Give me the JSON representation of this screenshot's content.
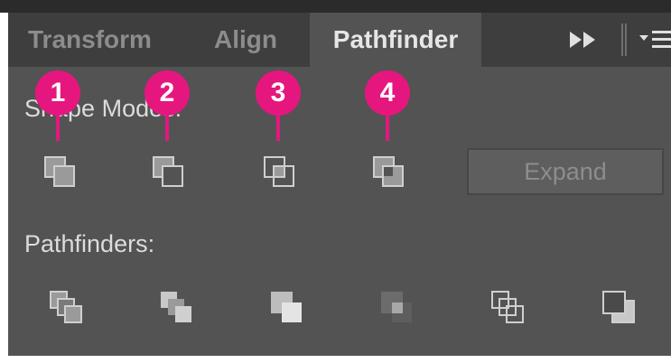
{
  "tabs": [
    {
      "label": "Transform",
      "active": false
    },
    {
      "label": "Align",
      "active": false
    },
    {
      "label": "Pathfinder",
      "active": true
    }
  ],
  "shape_modes": {
    "label": "Shape Modes:",
    "buttons": [
      "unite-icon",
      "minus-front-icon",
      "intersect-icon",
      "exclude-icon"
    ],
    "expand_label": "Expand"
  },
  "pathfinders": {
    "label": "Pathfinders:",
    "buttons": [
      "divide-icon",
      "trim-icon",
      "merge-icon",
      "crop-icon",
      "outline-icon",
      "minus-back-icon"
    ]
  },
  "callouts": [
    "1",
    "2",
    "3",
    "4"
  ],
  "colors": {
    "panel": "#535353",
    "tab_strip": "#3e3e3e",
    "accent": "#e6167f"
  }
}
